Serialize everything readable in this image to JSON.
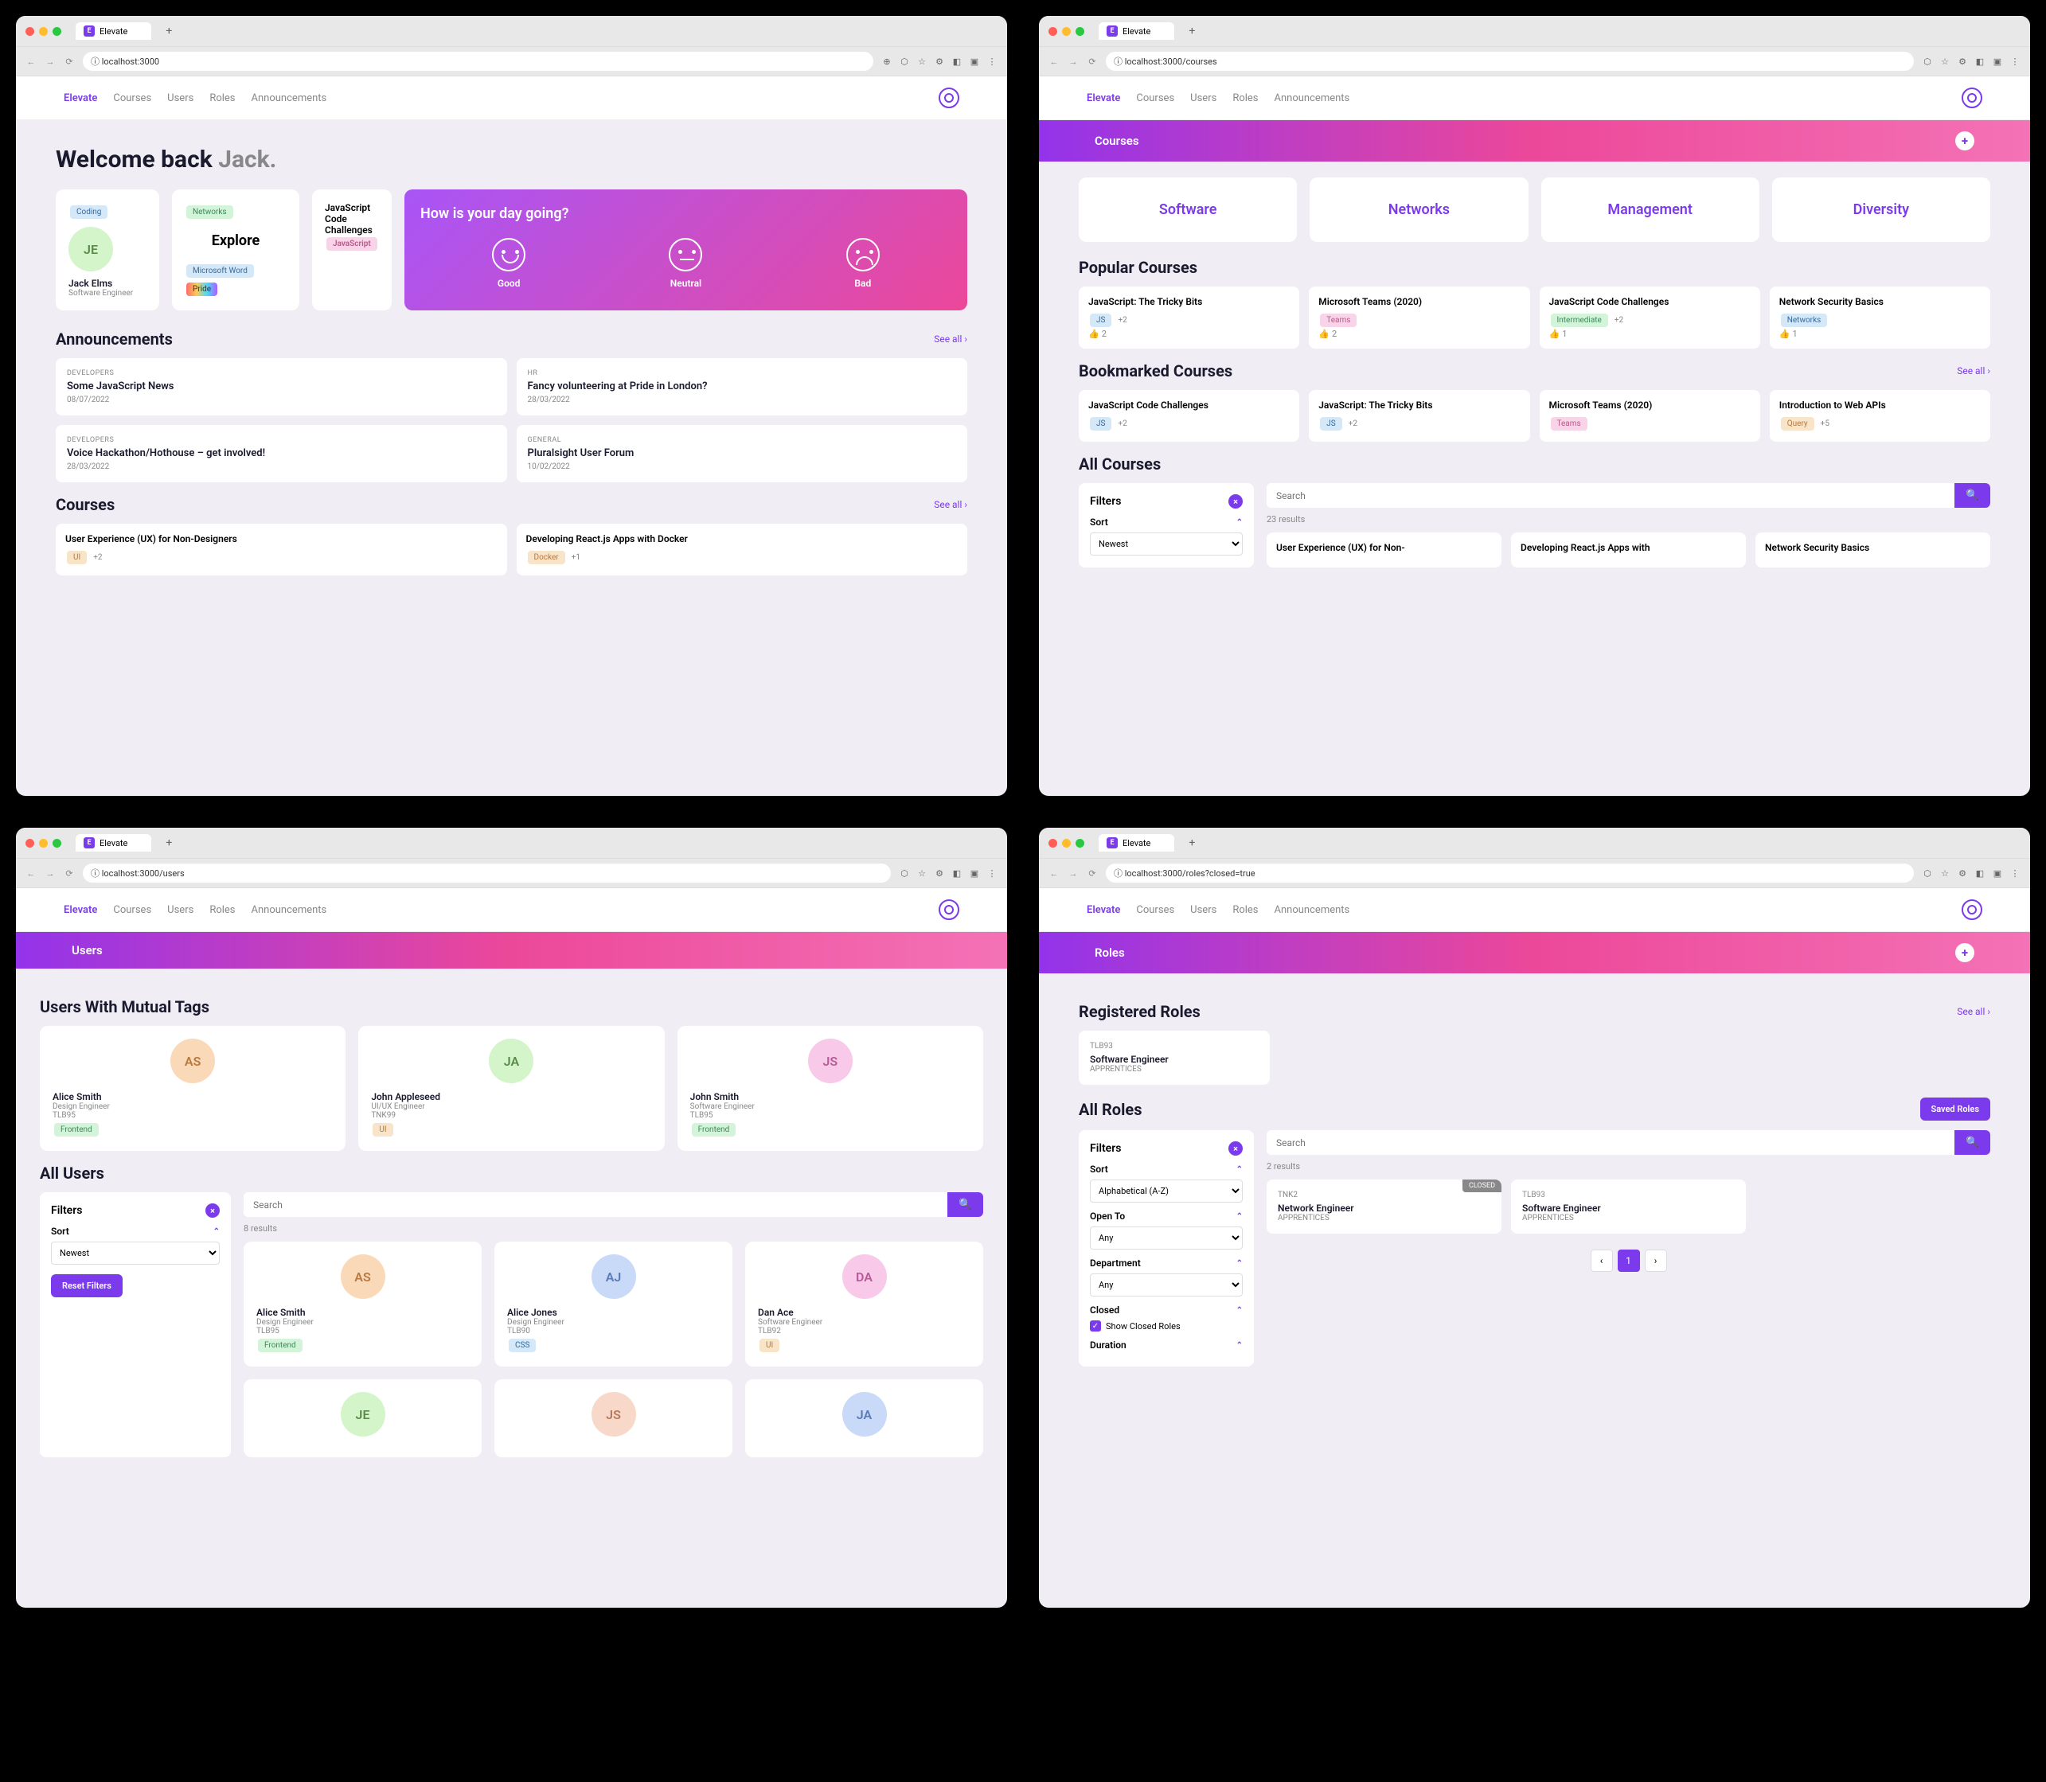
{
  "app": {
    "name": "Elevate",
    "tab_title": "Elevate"
  },
  "nav": {
    "items": [
      "Elevate",
      "Courses",
      "Users",
      "Roles",
      "Announcements"
    ]
  },
  "screens": {
    "home": {
      "url": "localhost:3000",
      "welcome_prefix": "Welcome back ",
      "welcome_name": "Jack.",
      "profile": {
        "badge": "Coding",
        "initials": "JE",
        "name": "Jack Elms",
        "role": "Software Engineer"
      },
      "explore": {
        "tag1": "Networks",
        "title": "Explore",
        "tag2": "Microsoft Word",
        "tag3": "Pride"
      },
      "jscard": {
        "title": "JavaScript Code Challenges",
        "tag": "JavaScript"
      },
      "mood": {
        "question": "How is your day going?",
        "opts": [
          "Good",
          "Neutral",
          "Bad"
        ]
      },
      "ann_title": "Announcements",
      "see_all": "See all",
      "announcements": [
        {
          "cat": "DEVELOPERS",
          "title": "Some JavaScript News",
          "date": "08/07/2022"
        },
        {
          "cat": "HR",
          "title": "Fancy volunteering at Pride in London?",
          "date": "28/03/2022"
        },
        {
          "cat": "DEVELOPERS",
          "title": "Voice Hackathon/Hothouse – get involved!",
          "date": "28/03/2022"
        },
        {
          "cat": "GENERAL",
          "title": "Pluralsight User Forum",
          "date": "10/02/2022"
        }
      ],
      "courses_title": "Courses",
      "courses": [
        {
          "title": "User Experience (UX) for Non-Designers",
          "tag": "UI",
          "extra": "+2"
        },
        {
          "title": "Developing React.js Apps with Docker",
          "tag": "Docker",
          "extra": "+1"
        }
      ]
    },
    "courses": {
      "url": "localhost:3000/courses",
      "header": "Courses",
      "categories": [
        "Software",
        "Networks",
        "Management",
        "Diversity"
      ],
      "pop_title": "Popular Courses",
      "popular": [
        {
          "title": "JavaScript: The Tricky Bits",
          "tag": "JS",
          "tagcls": "t-blue",
          "extra": "+2",
          "likes": "2"
        },
        {
          "title": "Microsoft Teams (2020)",
          "tag": "Teams",
          "tagcls": "t-pink",
          "extra": "",
          "likes": "2"
        },
        {
          "title": "JavaScript Code Challenges",
          "tag": "Intermediate",
          "tagcls": "t-green",
          "extra": "+2",
          "likes": "1"
        },
        {
          "title": "Network Security Basics",
          "tag": "Networks",
          "tagcls": "t-blue",
          "extra": "",
          "likes": "1"
        }
      ],
      "bm_title": "Bookmarked Courses",
      "bookmarked": [
        {
          "title": "JavaScript Code Challenges",
          "tag": "JS",
          "tagcls": "t-blue",
          "extra": "+2"
        },
        {
          "title": "JavaScript: The Tricky Bits",
          "tag": "JS",
          "tagcls": "t-blue",
          "extra": "+2"
        },
        {
          "title": "Microsoft Teams (2020)",
          "tag": "Teams",
          "tagcls": "t-pink",
          "extra": ""
        },
        {
          "title": "Introduction to Web APIs",
          "tag": "Query",
          "tagcls": "t-orange",
          "extra": "+5"
        }
      ],
      "all_title": "All Courses",
      "filters_label": "Filters",
      "sort_label": "Sort",
      "sort_value": "Newest",
      "search_ph": "Search",
      "results": "23 results",
      "all": [
        {
          "title": "User Experience (UX) for Non-"
        },
        {
          "title": "Developing React.js Apps with"
        },
        {
          "title": "Network Security Basics"
        }
      ]
    },
    "users": {
      "url": "localhost:3000/users",
      "header": "Users",
      "mutual_title": "Users With Mutual Tags",
      "mutual": [
        {
          "initials": "AS",
          "avcls": "av-orange",
          "name": "Alice Smith",
          "role": "Design Engineer",
          "code": "TLB95",
          "tag": "Frontend",
          "tagcls": "t-green"
        },
        {
          "initials": "JA",
          "avcls": "av-green",
          "name": "John Appleseed",
          "role": "UI/UX Engineer",
          "code": "TNK99",
          "tag": "UI",
          "tagcls": "t-orange"
        },
        {
          "initials": "JS",
          "avcls": "av-pink",
          "name": "John Smith",
          "role": "Software Engineer",
          "code": "TLB95",
          "tag": "Frontend",
          "tagcls": "t-green"
        }
      ],
      "all_title": "All Users",
      "filters_label": "Filters",
      "sort_label": "Sort",
      "sort_value": "Newest",
      "reset": "Reset Filters",
      "search_ph": "Search",
      "results": "8 results",
      "all": [
        {
          "initials": "AS",
          "avcls": "av-orange",
          "name": "Alice Smith",
          "role": "Design Engineer",
          "code": "TLB95",
          "tag": "Frontend",
          "tagcls": "t-green"
        },
        {
          "initials": "AJ",
          "avcls": "av-blue",
          "name": "Alice Jones",
          "role": "Design Engineer",
          "code": "TLB90",
          "tag": "CSS",
          "tagcls": "t-blue"
        },
        {
          "initials": "DA",
          "avcls": "av-pink",
          "name": "Dan Ace",
          "role": "Software Engineer",
          "code": "TLB92",
          "tag": "UI",
          "tagcls": "t-orange"
        },
        {
          "initials": "JE",
          "avcls": "av-green"
        },
        {
          "initials": "JS",
          "avcls": "av-peach"
        },
        {
          "initials": "JA",
          "avcls": "av-blue"
        }
      ]
    },
    "roles": {
      "url": "localhost:3000/roles?closed=true",
      "header": "Roles",
      "reg_title": "Registered Roles",
      "see_all": "See all",
      "registered": [
        {
          "code": "TLB93",
          "title": "Software Engineer",
          "sub": "APPRENTICES"
        }
      ],
      "all_title": "All Roles",
      "saved": "Saved Roles",
      "filters_label": "Filters",
      "sort_label": "Sort",
      "sort_value": "Alphabetical (A-Z)",
      "open_label": "Open To",
      "open_value": "Any",
      "dept_label": "Department",
      "dept_value": "Any",
      "closed_label": "Closed",
      "closed_chk": "Show Closed Roles",
      "duration_label": "Duration",
      "search_ph": "Search",
      "results": "2 results",
      "all": [
        {
          "code": "TNK2",
          "title": "Network Engineer",
          "sub": "APPRENTICES",
          "closed": "CLOSED"
        },
        {
          "code": "TLB93",
          "title": "Software Engineer",
          "sub": "APPRENTICES",
          "closed": ""
        }
      ],
      "page": "1"
    }
  }
}
